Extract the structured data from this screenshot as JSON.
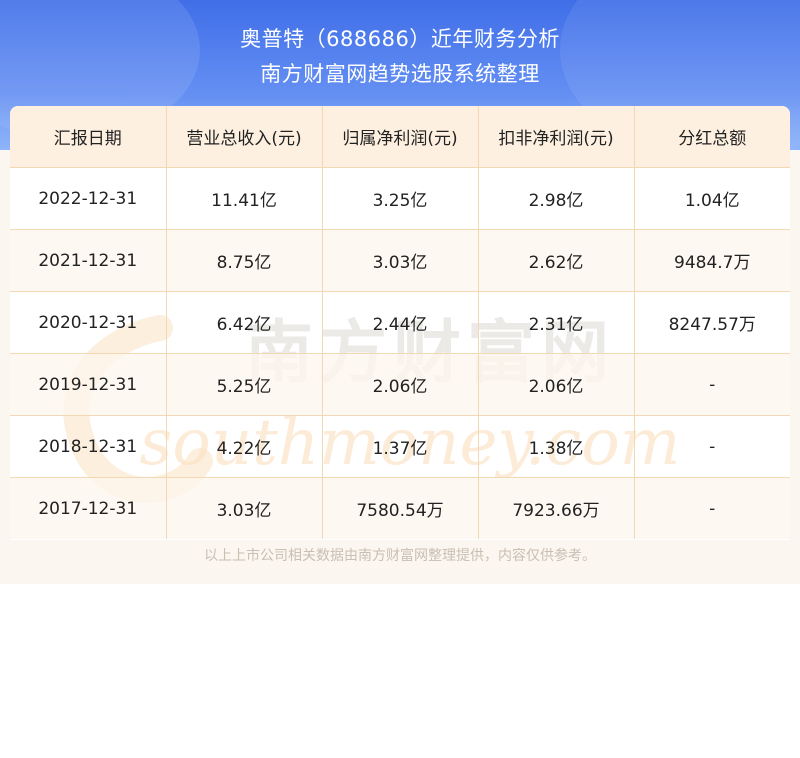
{
  "title": {
    "line1": "奥普特（688686）近年财务分析",
    "line2": "南方财富网趋势选股系统整理"
  },
  "table": {
    "headers": [
      "汇报日期",
      "营业总收入(元)",
      "归属净利润(元)",
      "扣非净利润(元)",
      "分红总额"
    ],
    "rows": [
      [
        "2022-12-31",
        "11.41亿",
        "3.25亿",
        "2.98亿",
        "1.04亿"
      ],
      [
        "2021-12-31",
        "8.75亿",
        "3.03亿",
        "2.62亿",
        "9484.7万"
      ],
      [
        "2020-12-31",
        "6.42亿",
        "2.44亿",
        "2.31亿",
        "8247.57万"
      ],
      [
        "2019-12-31",
        "5.25亿",
        "2.06亿",
        "2.06亿",
        "-"
      ],
      [
        "2018-12-31",
        "4.22亿",
        "1.37亿",
        "1.38亿",
        "-"
      ],
      [
        "2017-12-31",
        "3.03亿",
        "7580.54万",
        "7923.66万",
        "-"
      ]
    ]
  },
  "watermark": {
    "cn": "南方财富网",
    "en": "southmoney.com"
  },
  "footer": {
    "note": "以上上市公司相关数据由南方财富网整理提供，内容仅供参考。"
  },
  "colors": {
    "header_top": "#3f6ee8",
    "header_bottom": "#79a2f6",
    "table_border": "#f2d9b4",
    "thead_bg": "#fdf0e0",
    "footer_text": "#c9bfb3"
  }
}
